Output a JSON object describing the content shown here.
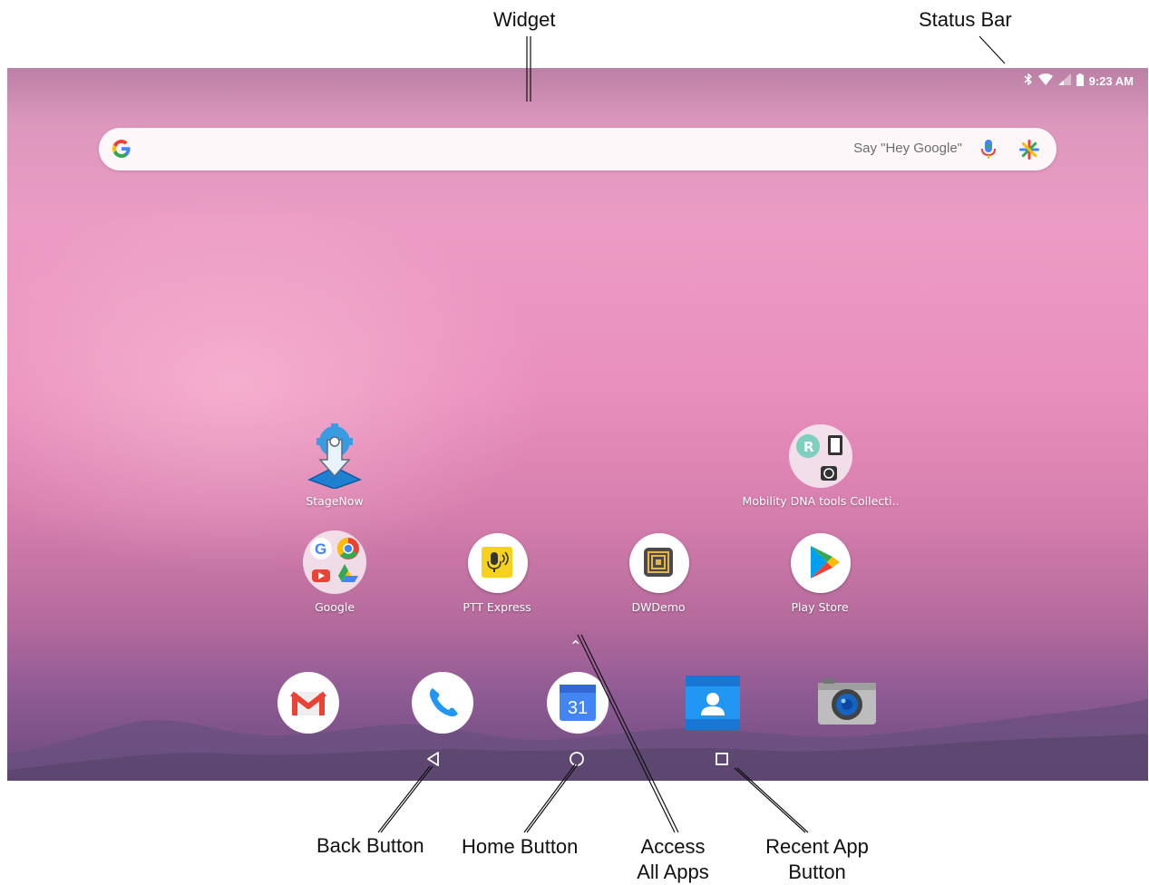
{
  "callouts": {
    "widget": "Widget",
    "status_bar": "Status Bar",
    "back_button": "Back Button",
    "home_button": "Home Button",
    "access_all_apps_line1": "Access",
    "access_all_apps_line2": "All Apps",
    "recent_app_line1": "Recent App",
    "recent_app_line2": "Button"
  },
  "status_bar": {
    "time": "9:23 AM",
    "icons": [
      "bluetooth-icon",
      "wifi-icon",
      "signal-icon",
      "battery-icon"
    ]
  },
  "search_widget": {
    "hint": "Say \"Hey Google\"",
    "icons": [
      "google-g-icon",
      "mic-icon",
      "google-lens-icon"
    ]
  },
  "home_apps": [
    {
      "label": "StageNow",
      "icon": "stagenow-icon"
    },
    {
      "label": "Mobility DNA tools Collecti..",
      "icon": "folder-icon"
    },
    {
      "label": "Google",
      "icon": "folder-icon"
    },
    {
      "label": "PTT Express",
      "icon": "ptt-express-icon"
    },
    {
      "label": "DWDemo",
      "icon": "dwdemo-icon"
    },
    {
      "label": "Play Store",
      "icon": "play-store-icon"
    }
  ],
  "dock": [
    "gmail-icon",
    "phone-icon",
    "calendar-icon",
    "contacts-icon",
    "camera-icon"
  ],
  "calendar_day": "31",
  "nav_bar": [
    "back-icon",
    "home-icon",
    "recents-icon"
  ],
  "colors": {
    "wallpaper_top": "#d495b8",
    "wallpaper_mid": "#ec9cc4",
    "wallpaper_bottom": "#6a4b7e",
    "google_blue": "#4285F4",
    "google_red": "#EA4335",
    "google_yellow": "#FBBC05",
    "google_green": "#34A853"
  }
}
